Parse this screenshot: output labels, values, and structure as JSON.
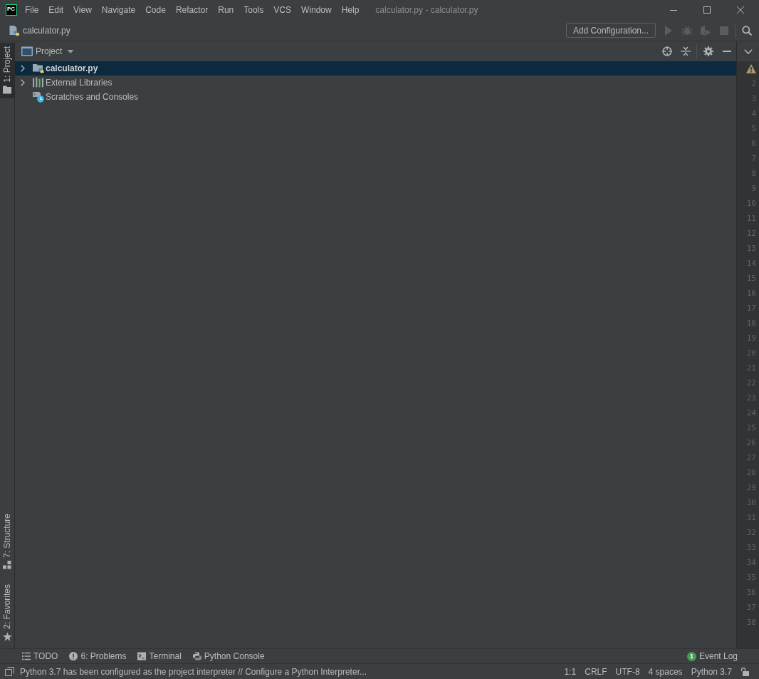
{
  "app": {
    "logo": "PC",
    "title": "calculator.py - calculator.py"
  },
  "menu": [
    "File",
    "Edit",
    "View",
    "Navigate",
    "Code",
    "Refactor",
    "Run",
    "Tools",
    "VCS",
    "Window",
    "Help"
  ],
  "navigation_bar": {
    "breadcrumb": "calculator.py",
    "run_configuration": "Add Configuration...",
    "actions": [
      {
        "kind": "run",
        "disabled": true
      },
      {
        "kind": "debug",
        "disabled": true
      },
      {
        "kind": "coverage",
        "disabled": true
      },
      {
        "kind": "stop",
        "disabled": true
      }
    ]
  },
  "left_stripe": {
    "top": [
      {
        "label": "1: Project",
        "kind": "project",
        "selected": true
      }
    ],
    "bottom": [
      {
        "label": "7: Structure",
        "kind": "structure",
        "selected": false
      },
      {
        "label": "2: Favorites",
        "kind": "favorites",
        "selected": false
      }
    ]
  },
  "project_panel": {
    "title": "Project",
    "tree": [
      {
        "label": "calculator.py",
        "kind": "project",
        "expanded": false,
        "selected": true
      },
      {
        "label": "External Libraries",
        "kind": "libraries",
        "expanded": false,
        "selected": false
      },
      {
        "label": "Scratches and Consoles",
        "kind": "scratches",
        "selected": false
      }
    ]
  },
  "editor": {
    "gutter": [
      {
        "kind": "warning"
      },
      {
        "kind": "number",
        "text": "2"
      },
      {
        "kind": "number",
        "text": "3"
      },
      {
        "kind": "number",
        "text": "4"
      },
      {
        "kind": "number",
        "text": "5"
      },
      {
        "kind": "number",
        "text": "6"
      },
      {
        "kind": "number",
        "text": "7"
      },
      {
        "kind": "number",
        "text": "8"
      },
      {
        "kind": "number",
        "text": "9"
      },
      {
        "kind": "number",
        "text": "10"
      },
      {
        "kind": "number",
        "text": "11"
      },
      {
        "kind": "number",
        "text": "12"
      },
      {
        "kind": "number",
        "text": "13"
      },
      {
        "kind": "number",
        "text": "14"
      },
      {
        "kind": "number",
        "text": "15"
      },
      {
        "kind": "number",
        "text": "16"
      },
      {
        "kind": "number",
        "text": "17"
      },
      {
        "kind": "number",
        "text": "18"
      },
      {
        "kind": "number",
        "text": "19"
      },
      {
        "kind": "number",
        "text": "20"
      },
      {
        "kind": "number",
        "text": "21"
      },
      {
        "kind": "number",
        "text": "22"
      },
      {
        "kind": "number",
        "text": "23"
      },
      {
        "kind": "number",
        "text": "24"
      },
      {
        "kind": "number",
        "text": "25"
      },
      {
        "kind": "number",
        "text": "26"
      },
      {
        "kind": "number",
        "text": "27"
      },
      {
        "kind": "number",
        "text": "28"
      },
      {
        "kind": "number",
        "text": "29"
      },
      {
        "kind": "number",
        "text": "30"
      },
      {
        "kind": "number",
        "text": "31"
      },
      {
        "kind": "number",
        "text": "32"
      },
      {
        "kind": "number",
        "text": "33"
      },
      {
        "kind": "number",
        "text": "34"
      },
      {
        "kind": "number",
        "text": "35"
      },
      {
        "kind": "number",
        "text": "36"
      },
      {
        "kind": "number",
        "text": "37"
      },
      {
        "kind": "number",
        "text": "38"
      }
    ]
  },
  "tool_window_bar": {
    "tabs": [
      {
        "label": "TODO",
        "kind": "todo",
        "selected": false
      },
      {
        "label": "6: Problems",
        "kind": "problems",
        "selected": false
      },
      {
        "label": "Terminal",
        "kind": "terminal",
        "selected": false
      },
      {
        "label": "Python Console",
        "kind": "python",
        "selected": false
      }
    ],
    "event_log": {
      "label": "Event Log",
      "badge": "1",
      "selected": false
    }
  },
  "status_bar": {
    "message": "Python 3.7 has been configured as the project interpreter // Configure a Python Interpreter...",
    "items": [
      "1:1",
      "CRLF",
      "UTF-8",
      "4 spaces",
      "Python 3.7"
    ]
  }
}
